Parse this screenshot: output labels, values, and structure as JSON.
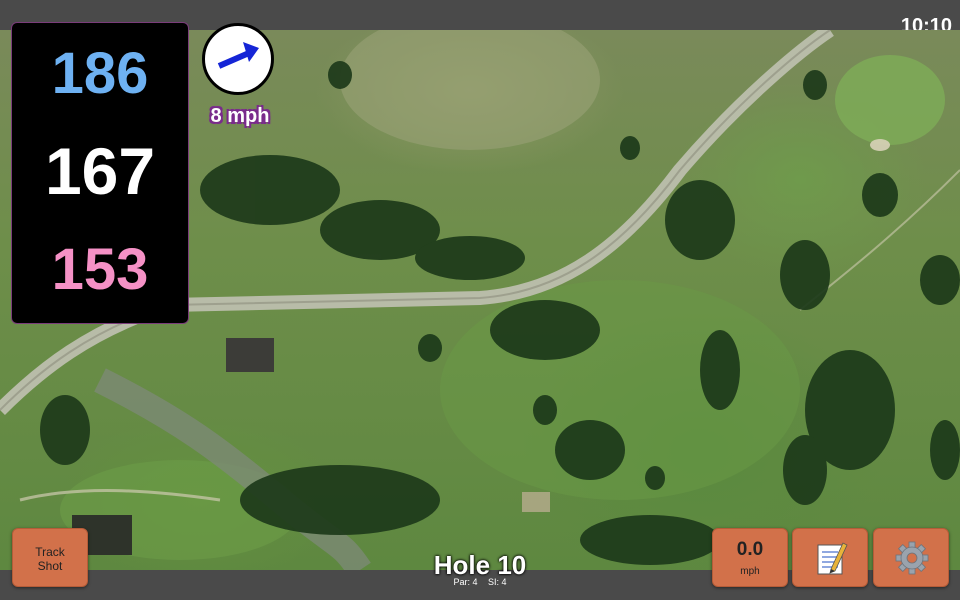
{
  "status_bar": {
    "clock": "10:10"
  },
  "distances": {
    "back": "186",
    "middle": "167",
    "front": "153"
  },
  "wind": {
    "speed_label": "8 mph",
    "arrow_icon": "wind-direction-arrow-icon"
  },
  "hole": {
    "title": "Hole 10",
    "par": "Par: 4",
    "stroke_index": "SI: 4"
  },
  "buttons": {
    "track_shot": "Track\nShot",
    "speed_value": "0.0",
    "speed_unit": "mph",
    "scorecard_icon": "notepad-icon",
    "settings_icon": "gear-icon"
  },
  "colors": {
    "back_distance": "#6eb1f2",
    "middle_distance": "#ffffff",
    "front_distance": "#f591c6",
    "button": "#d2714a",
    "wind_arrow": "#1525d6"
  }
}
